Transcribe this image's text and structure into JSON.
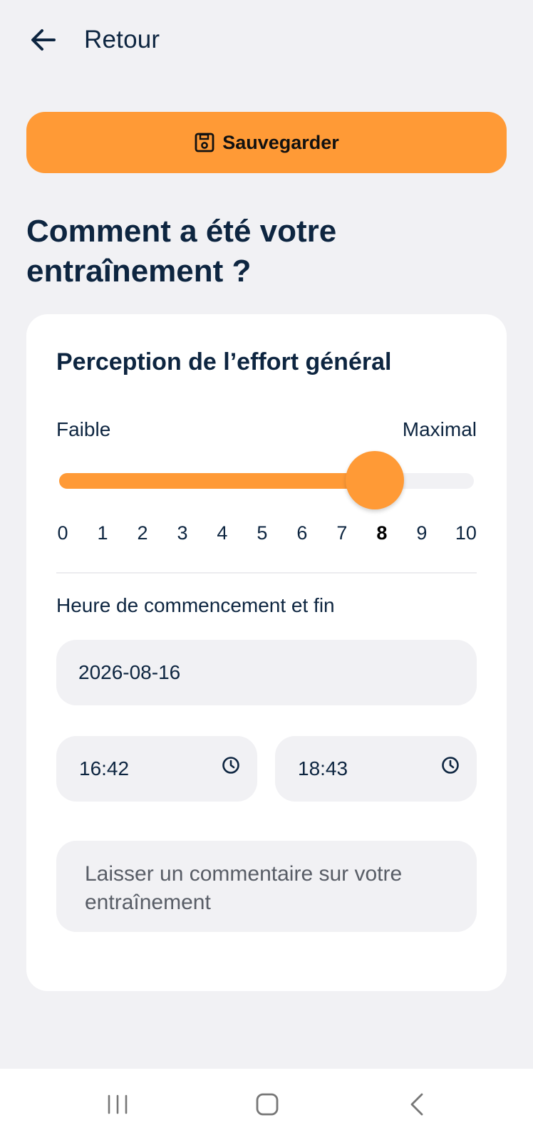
{
  "header": {
    "back_label": "Retour"
  },
  "toolbar": {
    "save_label": "Sauvegarder"
  },
  "heading": "Comment a été votre entraînement ?",
  "effort": {
    "title": "Perception de l’effort général",
    "min_label": "Faible",
    "max_label": "Maximal",
    "value": 8,
    "max": 10,
    "ticks": [
      "0",
      "1",
      "2",
      "3",
      "4",
      "5",
      "6",
      "7",
      "8",
      "9",
      "10"
    ]
  },
  "time": {
    "label": "Heure de commencement et fin",
    "date": "2026-08-16",
    "start": "16:42",
    "end": "18:43"
  },
  "comment": {
    "placeholder": "Laisser un commentaire sur votre entraînement"
  },
  "icons": {
    "back": "arrow-left-icon",
    "save": "floppy-disk-icon",
    "clock": "clock-icon",
    "nav_recent": "recent-apps-icon",
    "nav_home": "home-icon",
    "nav_back": "chevron-left-icon"
  },
  "colors": {
    "accent": "#ff9a36",
    "text": "#0d2540",
    "background": "#f1f1f4",
    "card": "#ffffff"
  }
}
